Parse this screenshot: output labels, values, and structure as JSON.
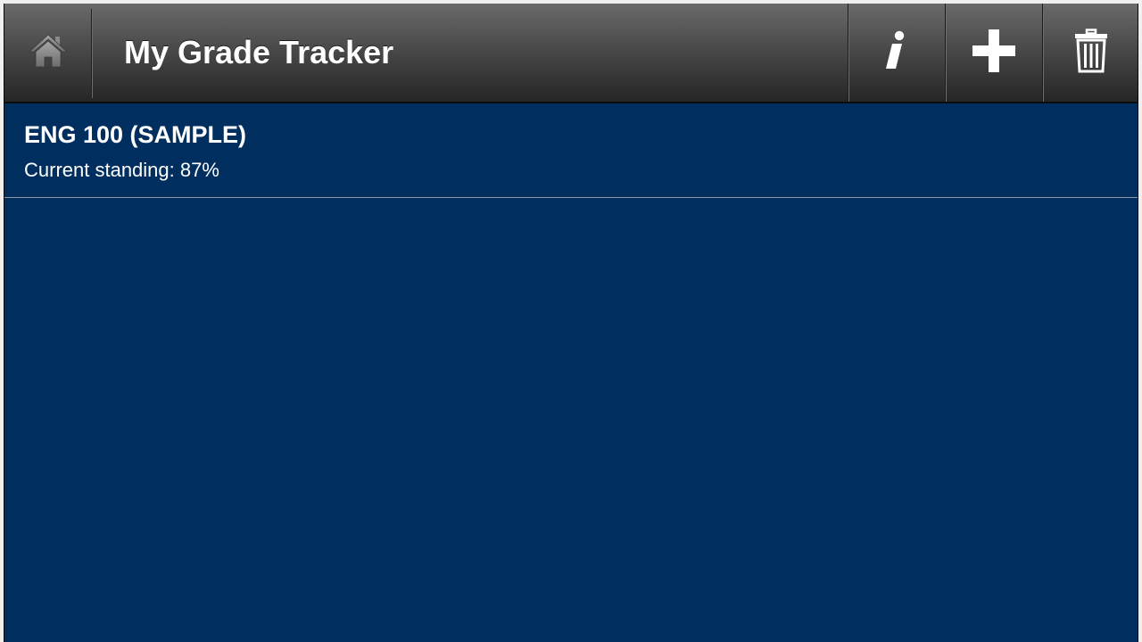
{
  "header": {
    "title": "My Grade Tracker",
    "icons": {
      "home": "home-icon",
      "info": "info-icon",
      "add": "plus-icon",
      "delete": "trash-icon"
    }
  },
  "courses": [
    {
      "name": "ENG 100 (SAMPLE)",
      "standing": "Current standing: 87%"
    }
  ],
  "colors": {
    "background": "#002f5f",
    "toolbar_top": "#6a6a6a",
    "toolbar_bottom": "#262626",
    "text": "#ffffff"
  }
}
